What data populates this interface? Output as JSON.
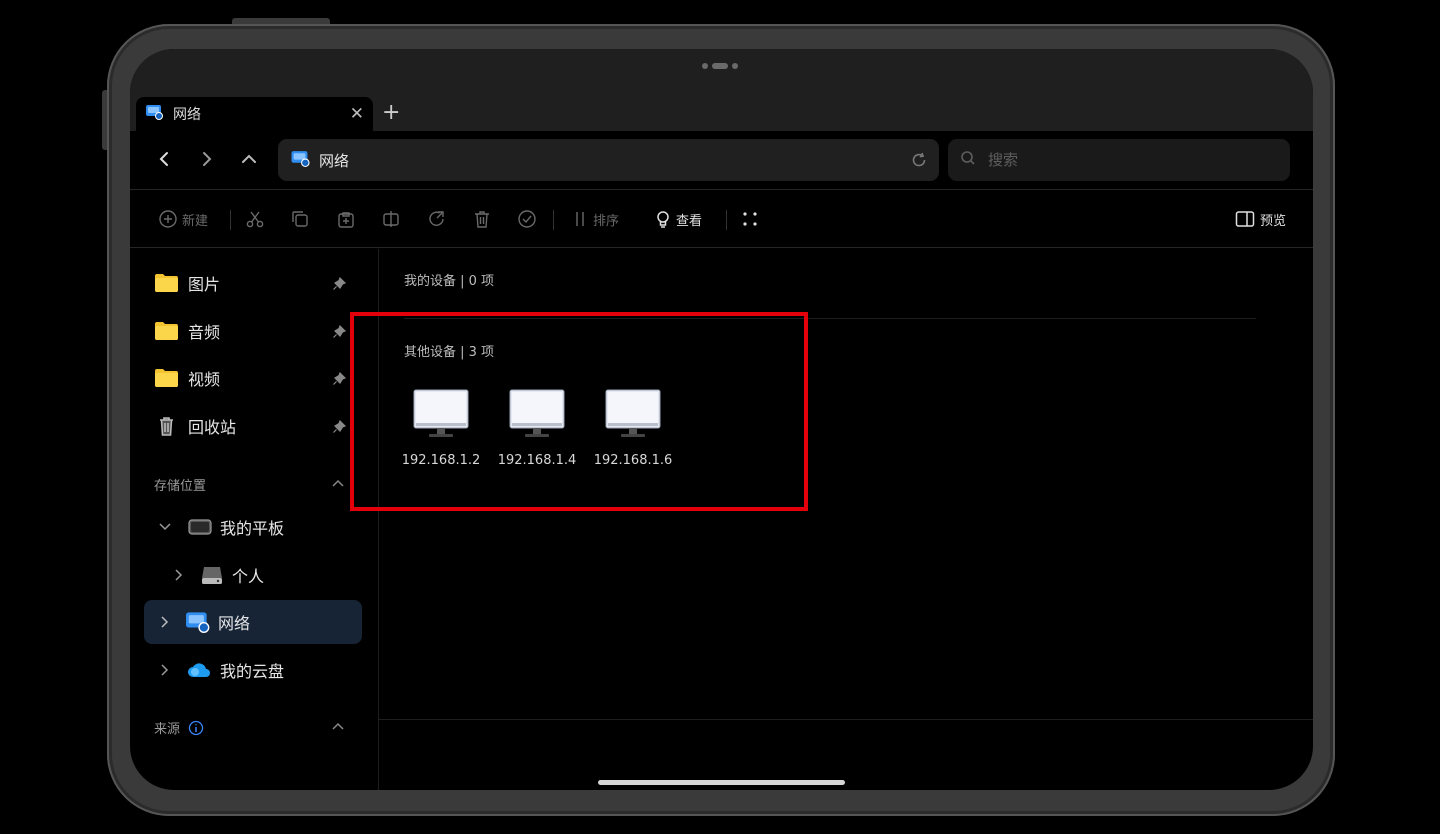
{
  "tab": {
    "title": "网络"
  },
  "address_bar": {
    "path": "网络"
  },
  "search": {
    "placeholder": "搜索"
  },
  "toolbar": {
    "new_label": "新建",
    "sort_label": "排序",
    "view_label": "查看",
    "preview_label": "预览"
  },
  "sidebar": {
    "quick_access": [
      {
        "label": "图片",
        "icon": "folder-icon"
      },
      {
        "label": "音频",
        "icon": "folder-icon"
      },
      {
        "label": "视频",
        "icon": "folder-icon"
      },
      {
        "label": "回收站",
        "icon": "trash-icon"
      }
    ],
    "storage_title": "存储位置",
    "storage": [
      {
        "label": "我的平板",
        "icon": "tablet-icon",
        "expanded": true
      },
      {
        "label": "个人",
        "icon": "drive-icon"
      },
      {
        "label": "网络",
        "icon": "network-icon",
        "selected": true
      },
      {
        "label": "我的云盘",
        "icon": "cloud-icon"
      }
    ],
    "sources_title": "来源"
  },
  "content": {
    "my_devices_title": "我的设备 | 0 项",
    "other_devices_title": "其他设备 | 3 项",
    "devices": [
      {
        "label": "192.168.1.2"
      },
      {
        "label": "192.168.1.4"
      },
      {
        "label": "192.168.1.6"
      }
    ]
  },
  "colors": {
    "highlight": "#e3000b",
    "folder": "#f4c430",
    "selected_bg": "#162436",
    "network_icon": "#2f8ef0",
    "cloud_icon": "#1d9bf0"
  }
}
